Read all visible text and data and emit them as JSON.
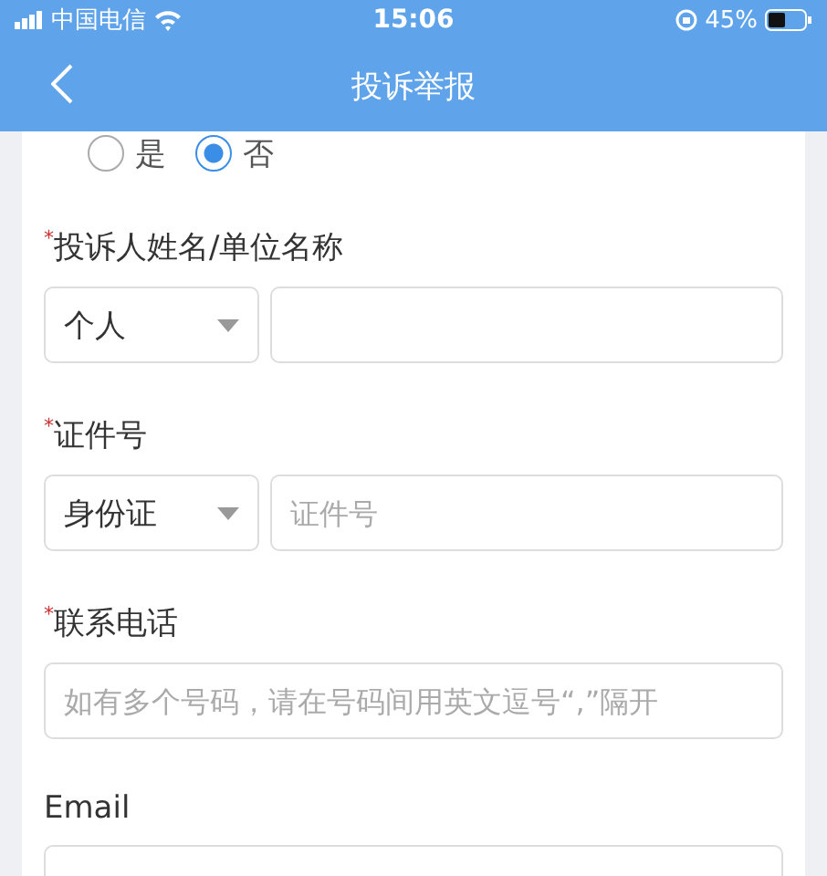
{
  "status_bar": {
    "carrier": "中国电信",
    "time": "15:06",
    "battery": "45%"
  },
  "nav": {
    "title": "投诉举报"
  },
  "radio_options": [
    {
      "label": "是",
      "selected": false
    },
    {
      "label": "否",
      "selected": true
    }
  ],
  "fields": [
    {
      "label": "投诉人姓名/单位名称",
      "required_mark": "*",
      "select": "个人"
    },
    {
      "label": "证件号",
      "required_mark": "*",
      "select": "身份证",
      "placeholder": "证件号"
    },
    {
      "label": "联系电话",
      "required_mark": "*",
      "placeholder": "如有多个号码，请在号码间用英文逗号“,”隔开"
    },
    {
      "label": "Email"
    }
  ]
}
